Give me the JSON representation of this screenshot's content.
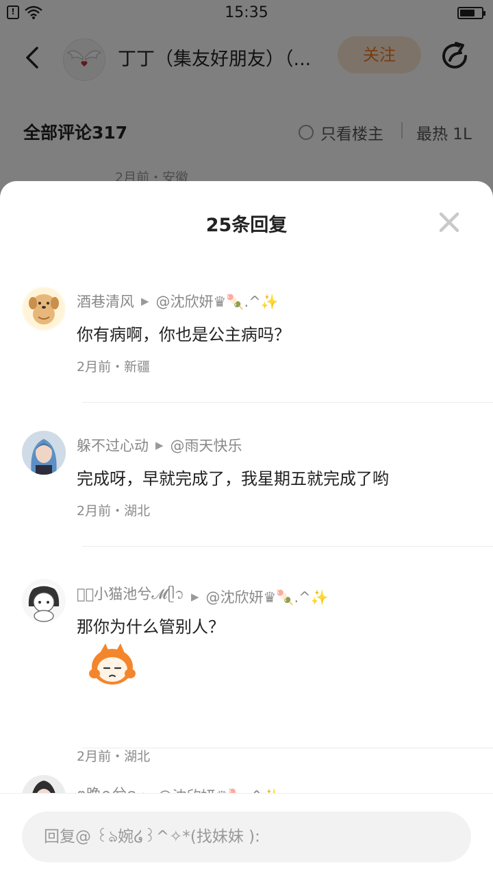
{
  "status_bar": {
    "time": "15:35",
    "battery_level": 0.7
  },
  "post_header": {
    "author_name": "丁丁（集友好朋友）（...",
    "follow_label": "关注"
  },
  "comments_header": {
    "all_comments": "全部评论317",
    "only_owner": "只看楼主",
    "sort_hot": "最热 1L"
  },
  "background_meta": "2月前・安徽",
  "sheet": {
    "title": "25条回复"
  },
  "replies": [
    {
      "author": "酒巷清风",
      "reply_to": "@沈欣妍♛🍡.^✨",
      "text": "你有病啊，你也是公主病吗？",
      "meta": "2月前・新疆"
    },
    {
      "author": "躲不过心动",
      "reply_to": "@雨天快乐",
      "text": "完成呀，早就完成了，我星期五就完成了哟",
      "meta": "2月前・湖北"
    },
    {
      "author": "𝓜ꦿ小猫池兮𝓜ᥫ᭡",
      "reply_to": "@沈欣妍♛🍡.^✨",
      "text": "那你为什么管别人？",
      "meta": "2月前・湖北"
    },
    {
      "author": "ฅ晚ꪆ兮ɞ",
      "reply_to": "@沈欣妍♛🍡.^✨",
      "text": "",
      "meta": ""
    }
  ],
  "input": {
    "placeholder": "回复@ ꒰ঌ婉໒꒱^✧*(找妹妹 ):"
  },
  "icons": {
    "back": "back-arrow-icon",
    "share": "share-icon",
    "close": "close-icon",
    "reply_arrow": "play-triangle-icon",
    "wifi": "wifi-icon",
    "sim": "sim-icon",
    "battery": "battery-icon"
  },
  "colors": {
    "accent": "#f07a22",
    "follow_bg": "#fde6d3",
    "overlay": "rgba(0,0,0,0.5)"
  }
}
